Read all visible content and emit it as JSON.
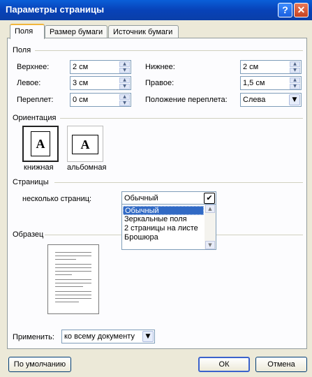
{
  "window": {
    "title": "Параметры страницы",
    "help_label": "?",
    "close_label": "✕"
  },
  "tabs": [
    {
      "label": "Поля"
    },
    {
      "label": "Размер бумаги"
    },
    {
      "label": "Источник бумаги"
    }
  ],
  "margins": {
    "group_label": "Поля",
    "top_label": "Верхнее:",
    "top_value": "2 см",
    "bottom_label": "Нижнее:",
    "bottom_value": "2 см",
    "left_label": "Левое:",
    "left_value": "3 см",
    "right_label": "Правое:",
    "right_value": "1,5 см",
    "gutter_label": "Переплет:",
    "gutter_value": "0 см",
    "gutter_pos_label": "Положение переплета:",
    "gutter_pos_value": "Слева"
  },
  "orientation": {
    "group_label": "Ориентация",
    "portrait_label": "книжная",
    "landscape_label": "альбомная",
    "page_glyph": "A"
  },
  "pages": {
    "group_label": "Страницы",
    "multiple_label": "несколько страниц:",
    "multiple_value": "Обычный",
    "options": [
      "Обычный",
      "Зеркальные поля",
      "2 страницы на листе",
      "Брошюра"
    ]
  },
  "preview": {
    "group_label": "Образец"
  },
  "apply": {
    "label": "Применить:",
    "value": "ко всему документу"
  },
  "buttons": {
    "default_label": "По умолчанию",
    "ok_label": "ОК",
    "cancel_label": "Отмена"
  },
  "colors": {
    "titlebar": "#0a5fd8",
    "selection": "#316ac5",
    "dialog_bg": "#ece9d8"
  }
}
